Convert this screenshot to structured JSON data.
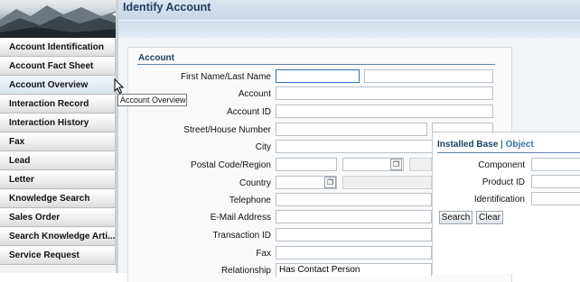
{
  "sidebar": {
    "items": [
      {
        "label": "Account Identification"
      },
      {
        "label": "Account Fact Sheet"
      },
      {
        "label": "Account Overview"
      },
      {
        "label": "Interaction Record"
      },
      {
        "label": "Interaction History"
      },
      {
        "label": "Fax"
      },
      {
        "label": "Lead"
      },
      {
        "label": "Letter"
      },
      {
        "label": "Knowledge Search"
      },
      {
        "label": "Sales Order"
      },
      {
        "label": "Search Knowledge Arti..."
      },
      {
        "label": "Service Request"
      }
    ],
    "tooltip": "Account Overview"
  },
  "header": {
    "title": "Identify Account"
  },
  "form": {
    "section_title": "Account",
    "fields": {
      "name": "First Name/Last Name",
      "account": "Account",
      "account_id": "Account ID",
      "street": "Street/House Number",
      "city": "City",
      "postal": "Postal Code/Region",
      "country": "Country",
      "telephone": "Telephone",
      "email": "E-Mail Address",
      "transaction_id": "Transaction ID",
      "fax": "Fax",
      "relationship": "Relationship"
    },
    "relationship_value": "Has Contact Person"
  },
  "popup": {
    "tab_installed_base": "Installed Base",
    "tab_separator": "|",
    "tab_object": "Object",
    "fields": {
      "component": "Component",
      "product_id": "Product ID",
      "identification": "Identification"
    },
    "search_label": "Search",
    "clear_label": "Clear"
  },
  "icons": {
    "picker": "value-help-icon",
    "cursor": "mouse-cursor-icon"
  },
  "colors": {
    "header_title": "#1d3e5e",
    "section_line": "#5f83a6",
    "focus_border": "#2c6fc1"
  }
}
